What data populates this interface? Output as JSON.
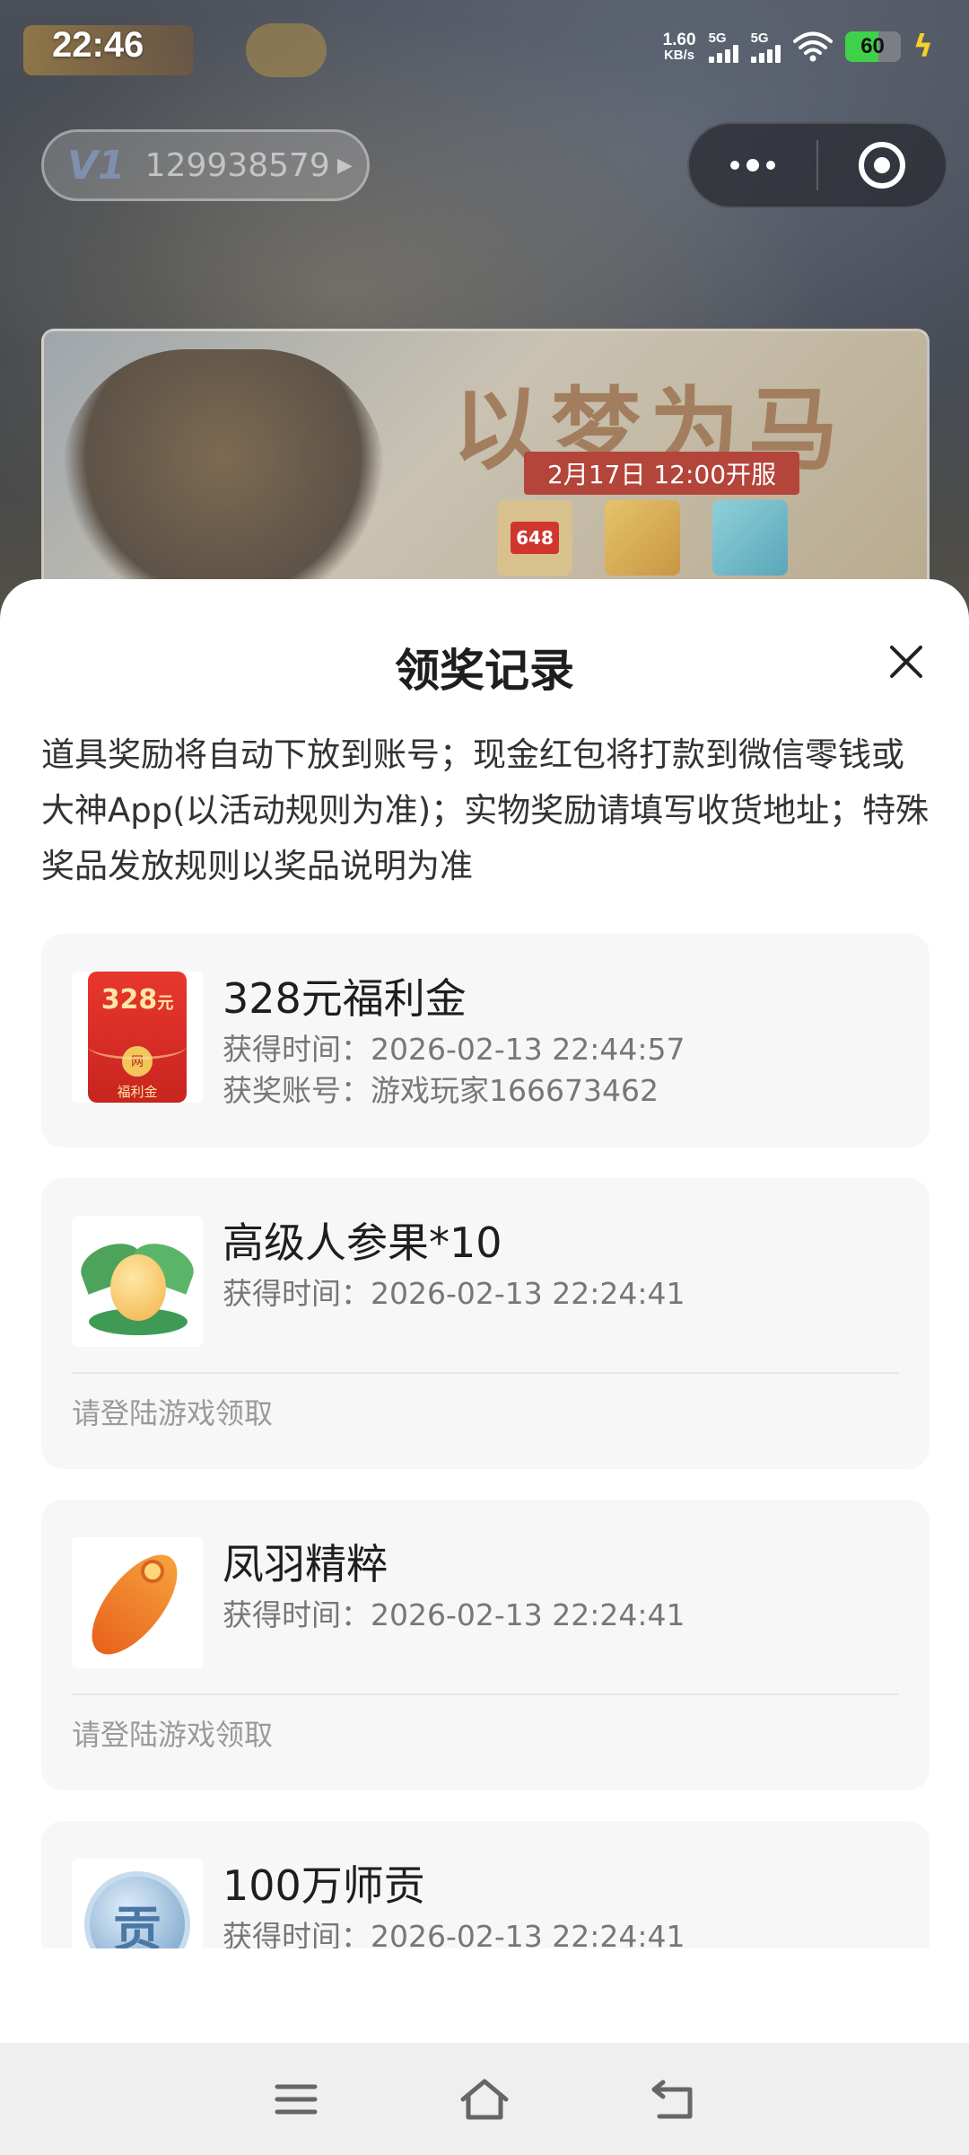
{
  "status_bar": {
    "time": "22:46",
    "net_speed_value": "1.60",
    "net_speed_unit": "KB/s",
    "signal1_label": "5G",
    "signal2_label": "5G",
    "battery_level": "60",
    "charging_icon": "bolt-icon"
  },
  "background_page": {
    "vip_badge": "V1",
    "user_id": "129938579",
    "banner_slogan": "以梦为马",
    "banner_date": "2月17日 12:00开服",
    "banner_gift1": "648"
  },
  "sheet": {
    "title": "领奖记录",
    "notice": "道具奖励将自动下放到账号；现金红包将打款到微信零钱或大神App(以活动规则为准)；实物奖励请填写收货地址；特殊奖品发放规则以奖品说明为准",
    "records": [
      {
        "name": "328元福利金",
        "time_label": "获得时间：",
        "time": "2026-02-13 22:44:57",
        "account_label": "获奖账号：",
        "account": "游戏玩家166673462",
        "thumb_amount": "328",
        "thumb_unit": "元",
        "thumb_caption": "福利金",
        "thumb_coin": "网",
        "icon": "red-envelope-icon"
      },
      {
        "name": "高级人参果*10",
        "time_label": "获得时间：",
        "time": "2026-02-13 22:24:41",
        "hint": "请登陆游戏领取",
        "icon": "ginseng-fruit-icon"
      },
      {
        "name": "凤羽精粹",
        "time_label": "获得时间：",
        "time": "2026-02-13 22:24:41",
        "hint": "请登陆游戏领取",
        "icon": "phoenix-feather-icon"
      },
      {
        "name": "100万师贡",
        "time_label": "获得时间：",
        "time": "2026-02-13 22:24:41",
        "thumb_char": "贡",
        "icon": "tribute-coin-icon"
      }
    ]
  },
  "nav_bar": {
    "menu_icon": "menu-icon",
    "home_icon": "home-icon",
    "back_icon": "back-icon"
  },
  "colors": {
    "sheet_background": "#ffffff",
    "card_background": "#f7f7f7",
    "title_text": "#1e1e1e",
    "muted_text": "#777777",
    "hint_text": "#9a9a9a",
    "battery_green": "#3fd14a",
    "red_envelope": "#e8372f"
  }
}
